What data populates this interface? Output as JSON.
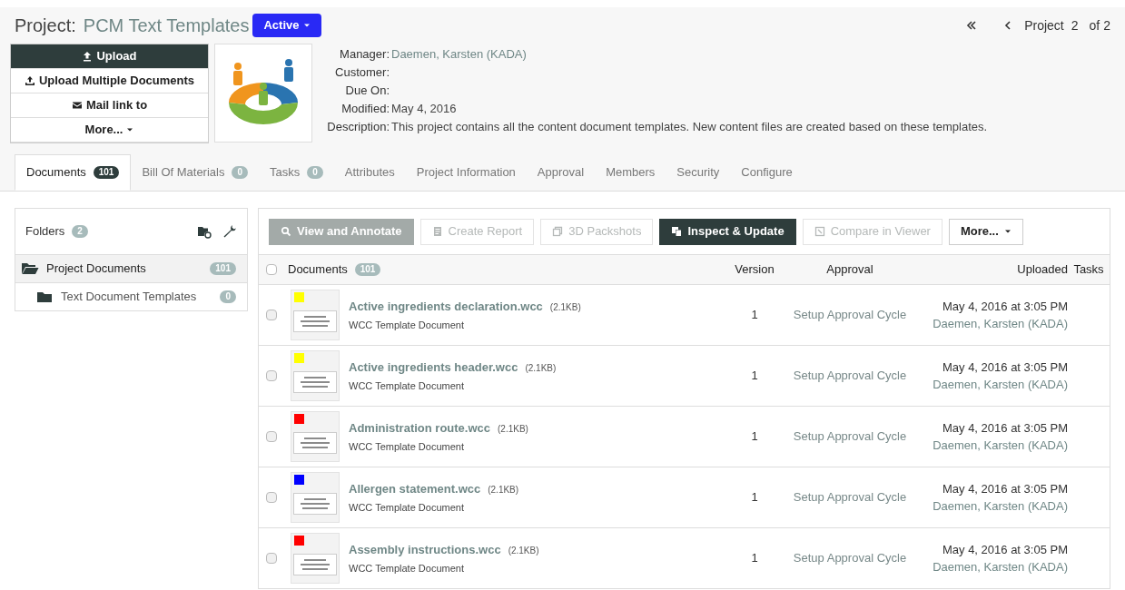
{
  "header": {
    "label": "Project:",
    "name": "PCM Text Templates",
    "status": "Active",
    "nav": {
      "text": "Project",
      "current": "2",
      "of": "of",
      "total": "2"
    }
  },
  "actions": [
    {
      "label": "Upload",
      "primary": true
    },
    {
      "label": "Upload Multiple Documents",
      "primary": false
    },
    {
      "label": "Mail link to",
      "primary": false
    },
    {
      "label": "More...",
      "primary": false
    }
  ],
  "details": [
    {
      "label": "Manager:",
      "value": "Daemen, Karsten (KADA)"
    },
    {
      "label": "Customer:"
    },
    {
      "label": "Due On:"
    },
    {
      "label": "Modified:",
      "value": "May 4, 2016"
    },
    {
      "label": "Description:",
      "value": "This project contains all the content document templates. New content files are created based on these templates."
    }
  ],
  "tabs": [
    {
      "label": "Documents",
      "count": "101",
      "selected": true
    },
    {
      "label": "Bill Of Materials",
      "count": "0",
      "selected": false
    },
    {
      "label": "Tasks",
      "count": "0",
      "selected": false
    },
    {
      "label": "Attributes",
      "selected": false
    },
    {
      "label": "Project Information",
      "selected": false
    },
    {
      "label": "Approval",
      "selected": false
    },
    {
      "label": "Members",
      "selected": false
    },
    {
      "label": "Security",
      "selected": false
    },
    {
      "label": "Configure",
      "selected": false
    }
  ],
  "folders": {
    "title": "Folders",
    "count": "2",
    "items": [
      {
        "label": "Project Documents",
        "count": "101",
        "selected": true,
        "children": [
          {
            "label": "Text Document Templates",
            "count": "0",
            "selected": false
          }
        ]
      }
    ]
  },
  "toolbar": [
    {
      "label": "View and Annotate",
      "disabled": false
    },
    {
      "label": "Create Report",
      "disabled": true
    },
    {
      "label": "3D Packshots",
      "disabled": true
    },
    {
      "label": "Inspect & Update",
      "disabled": false
    },
    {
      "label": "Compare in Viewer",
      "disabled": true
    },
    {
      "label": "More...",
      "disabled": false
    }
  ],
  "table": {
    "select_all_checked": false,
    "columns": [
      {
        "label": "Documents",
        "count": "101"
      },
      {
        "label": "Version"
      },
      {
        "label": "Approval"
      },
      {
        "label": "Uploaded"
      },
      {
        "label": "Tasks"
      }
    ],
    "rows": [
      {
        "name": "Active ingredients declaration.wcc",
        "size": "(2.1KB)",
        "type": "WCC Template Document",
        "color": "#ffff00",
        "version": "1",
        "approval": "Setup Approval Cycle",
        "date": "May 4, 2016 at 3:05 PM",
        "user": "Daemen, Karsten (KADA)",
        "checked": false
      },
      {
        "name": "Active ingredients header.wcc",
        "size": "(2.1KB)",
        "type": "WCC Template Document",
        "color": "#ffff00",
        "version": "1",
        "approval": "Setup Approval Cycle",
        "date": "May 4, 2016 at 3:05 PM",
        "user": "Daemen, Karsten (KADA)",
        "checked": false
      },
      {
        "name": "Administration route.wcc",
        "size": "(2.1KB)",
        "type": "WCC Template Document",
        "color": "#ff0000",
        "version": "1",
        "approval": "Setup Approval Cycle",
        "date": "May 4, 2016 at 3:05 PM",
        "user": "Daemen, Karsten (KADA)",
        "checked": false
      },
      {
        "name": "Allergen statement.wcc",
        "size": "(2.1KB)",
        "type": "WCC Template Document",
        "color": "#0000ff",
        "version": "1",
        "approval": "Setup Approval Cycle",
        "date": "May 4, 2016 at 3:05 PM",
        "user": "Daemen, Karsten (KADA)",
        "checked": false
      },
      {
        "name": "Assembly instructions.wcc",
        "size": "(2.1KB)",
        "type": "WCC Template Document",
        "color": "#ff0000",
        "version": "1",
        "approval": "Setup Approval Cycle",
        "date": "May 4, 2016 at 3:05 PM",
        "user": "Daemen, Karsten (KADA)",
        "checked": false
      }
    ]
  }
}
